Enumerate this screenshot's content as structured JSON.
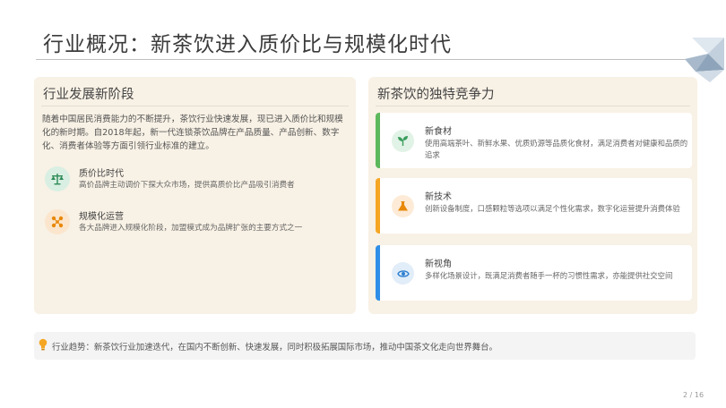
{
  "slide": {
    "title": "行业概况：新茶饮进入质价比与规模化时代",
    "page_number": "2 / 16"
  },
  "left_panel": {
    "heading": "行业发展新阶段",
    "intro": "随着中国居民消费能力的不断提升，茶饮行业快速发展，现已进入质价比和规模化的新时期。自2018年起，新一代连锁茶饮品牌在产品质量、产品创新、数字化、消费者体验等方面引领行业标准的建立。",
    "features": [
      {
        "icon": "scale-icon",
        "title": "质价比时代",
        "desc": "高价品牌主动调价下探大众市场，提供高质价比产品吸引消费者"
      },
      {
        "icon": "network-icon",
        "title": "规模化运营",
        "desc": "各大品牌进入规模化阶段，加盟模式成为品牌扩张的主要方式之一"
      }
    ]
  },
  "right_panel": {
    "heading": "新茶饮的独特竞争力",
    "cards": [
      {
        "icon": "leaf-icon",
        "title": "新食材",
        "desc": "使用高端茶叶、新鲜水果、优质奶源等品质化食材，满足消费者对健康和品质的追求"
      },
      {
        "icon": "flask-icon",
        "title": "新技术",
        "desc": "创新设备制度，口感颗粒等选项以满足个性化需求，数字化运营提升消费体验"
      },
      {
        "icon": "eye-icon",
        "title": "新视角",
        "desc": "多样化场景设计，既满足消费者随手一杯的习惯性需求，亦能提供社交空间"
      }
    ]
  },
  "trend": {
    "icon": "lightbulb-icon",
    "label": "行业趋势：",
    "text": "新茶饮行业加速迭代，在国内不断创新、快速发展，同时积极拓展国际市场，推动中国茶文化走向世界舞台。"
  },
  "colors": {
    "panel_bg": "#f8f1e5",
    "card_green": "#5cb85c",
    "card_orange": "#f5a623",
    "card_blue": "#2f8fe8",
    "bulb": "#f5a623"
  }
}
